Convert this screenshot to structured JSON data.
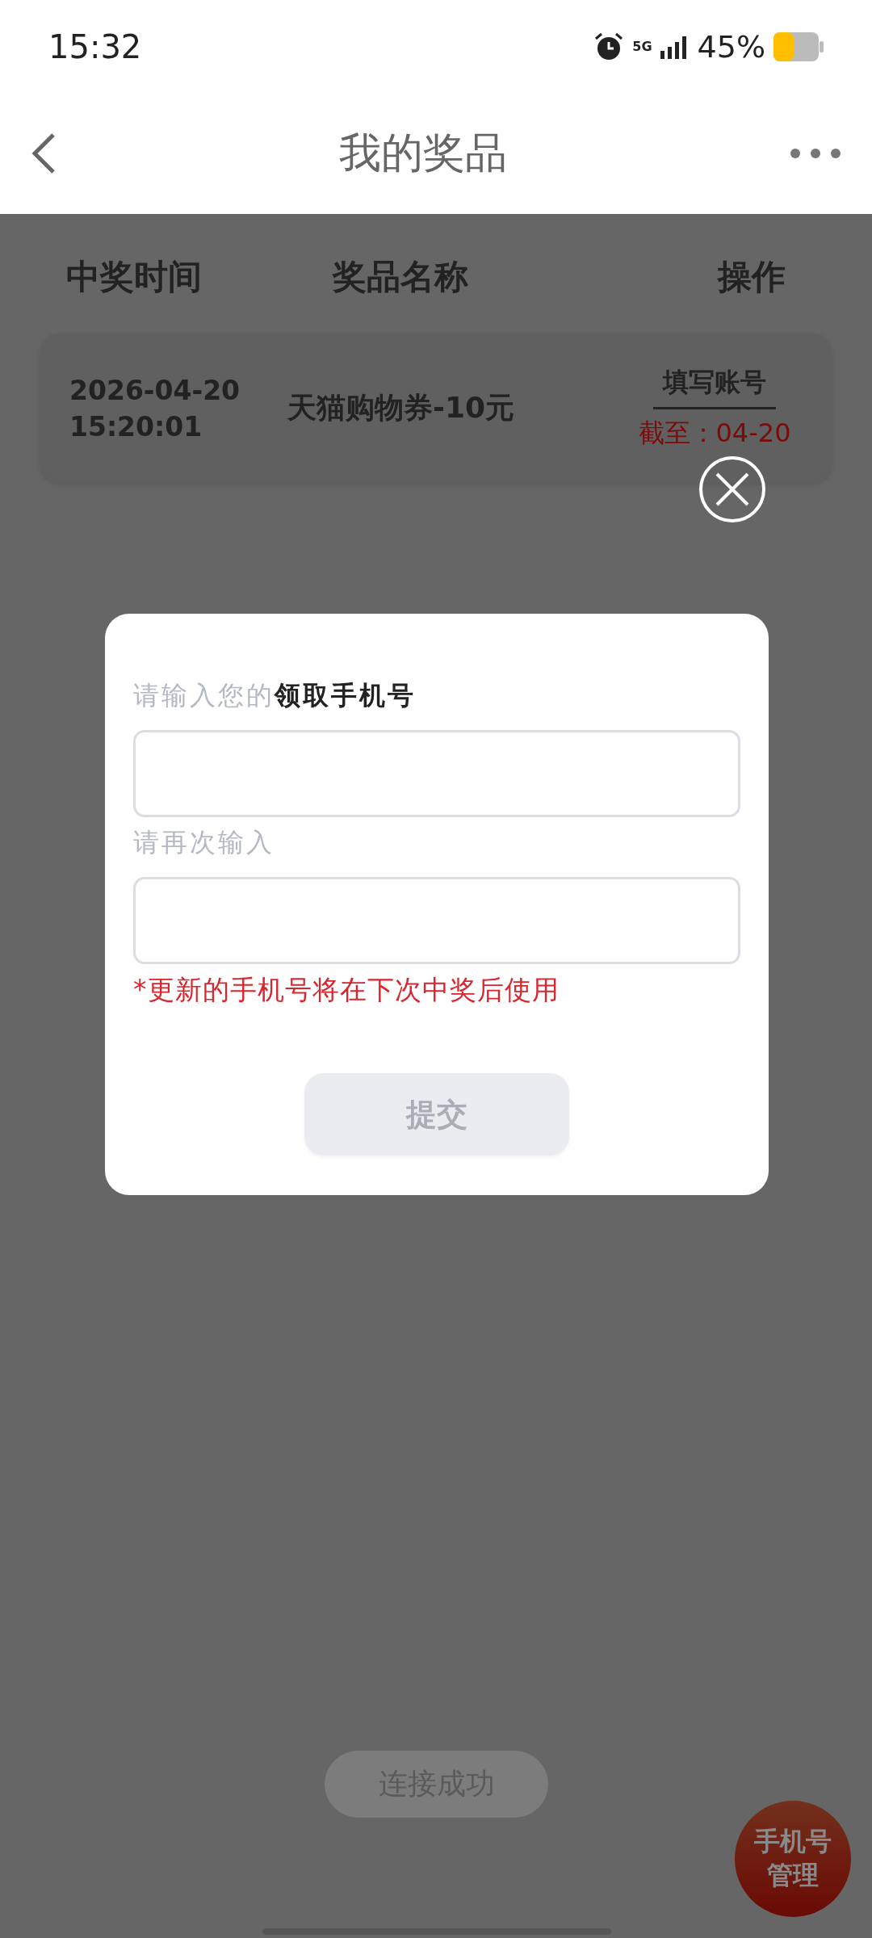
{
  "status_bar": {
    "time": "15:32",
    "network": "5G",
    "battery": "45%"
  },
  "nav": {
    "title": "我的奖品"
  },
  "table": {
    "columns": [
      "中奖时间",
      "奖品名称",
      "操作"
    ],
    "rows": [
      {
        "date": "2026-04-20",
        "clock": "15:20:01",
        "prize": "天猫购物券-10元",
        "action": "填写账号",
        "deadline": "截至：04-20"
      }
    ]
  },
  "dialog": {
    "prompt": "请输入您的**领取手机号**",
    "confirm_label": "请再次输入",
    "note": "*更新的手机号将在下次中奖后使用",
    "submit": {
      "label": "提交",
      "disabled": true
    }
  },
  "toast": "连接成功",
  "fab": {
    "lines": [
      "手机号",
      "管理"
    ]
  }
}
